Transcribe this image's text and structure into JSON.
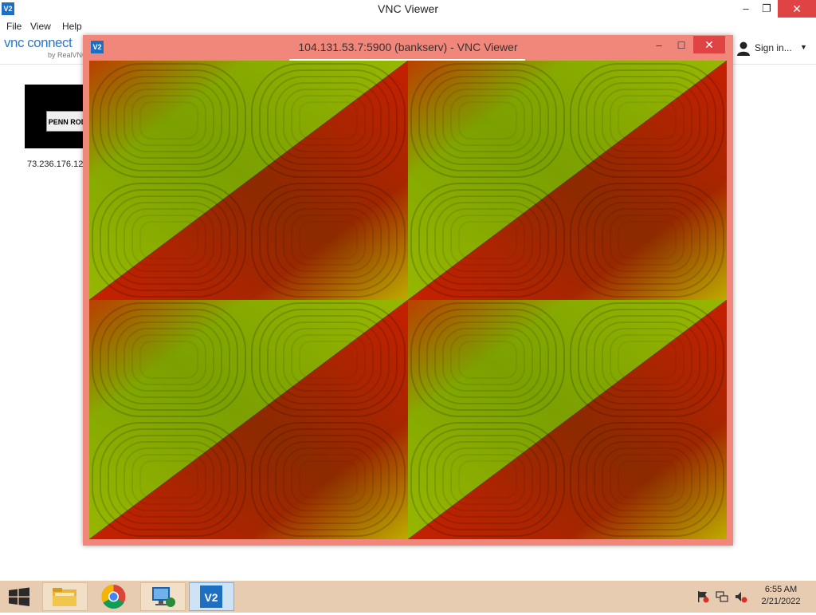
{
  "main_window": {
    "title": "VNC Viewer",
    "app_icon_text": "V2",
    "controls": {
      "minimize": "–",
      "restore": "❐",
      "close": "✕"
    }
  },
  "menu": {
    "file": "File",
    "view": "View",
    "help": "Help"
  },
  "toolbar": {
    "brand": "vnc connect",
    "brand_sub": "by RealVNC",
    "sign_in": "Sign in...",
    "sign_in_chevron": "▼"
  },
  "address_book": {
    "card_logo_text": "PENN ROD & GUN",
    "card_label": "73.236.176.12"
  },
  "session": {
    "title": "104.131.53.7:5900 (bankserv) - VNC Viewer",
    "app_icon_text": "V2",
    "controls": {
      "minimize": "–",
      "maximize": "☐",
      "close": "✕"
    }
  },
  "taskbar": {
    "apps": [
      "file-explorer",
      "google-chrome",
      "remote-desktop",
      "vnc-viewer"
    ],
    "clock_time": "6:55 AM",
    "clock_date": "2/21/2022"
  },
  "colors": {
    "session_frame": "#f0877a",
    "taskbar": "#e8ccb1",
    "close_button": "#e04343",
    "brand_blue": "#2f78c4",
    "pattern_green": "#7ef500",
    "pattern_red": "#c01800"
  }
}
